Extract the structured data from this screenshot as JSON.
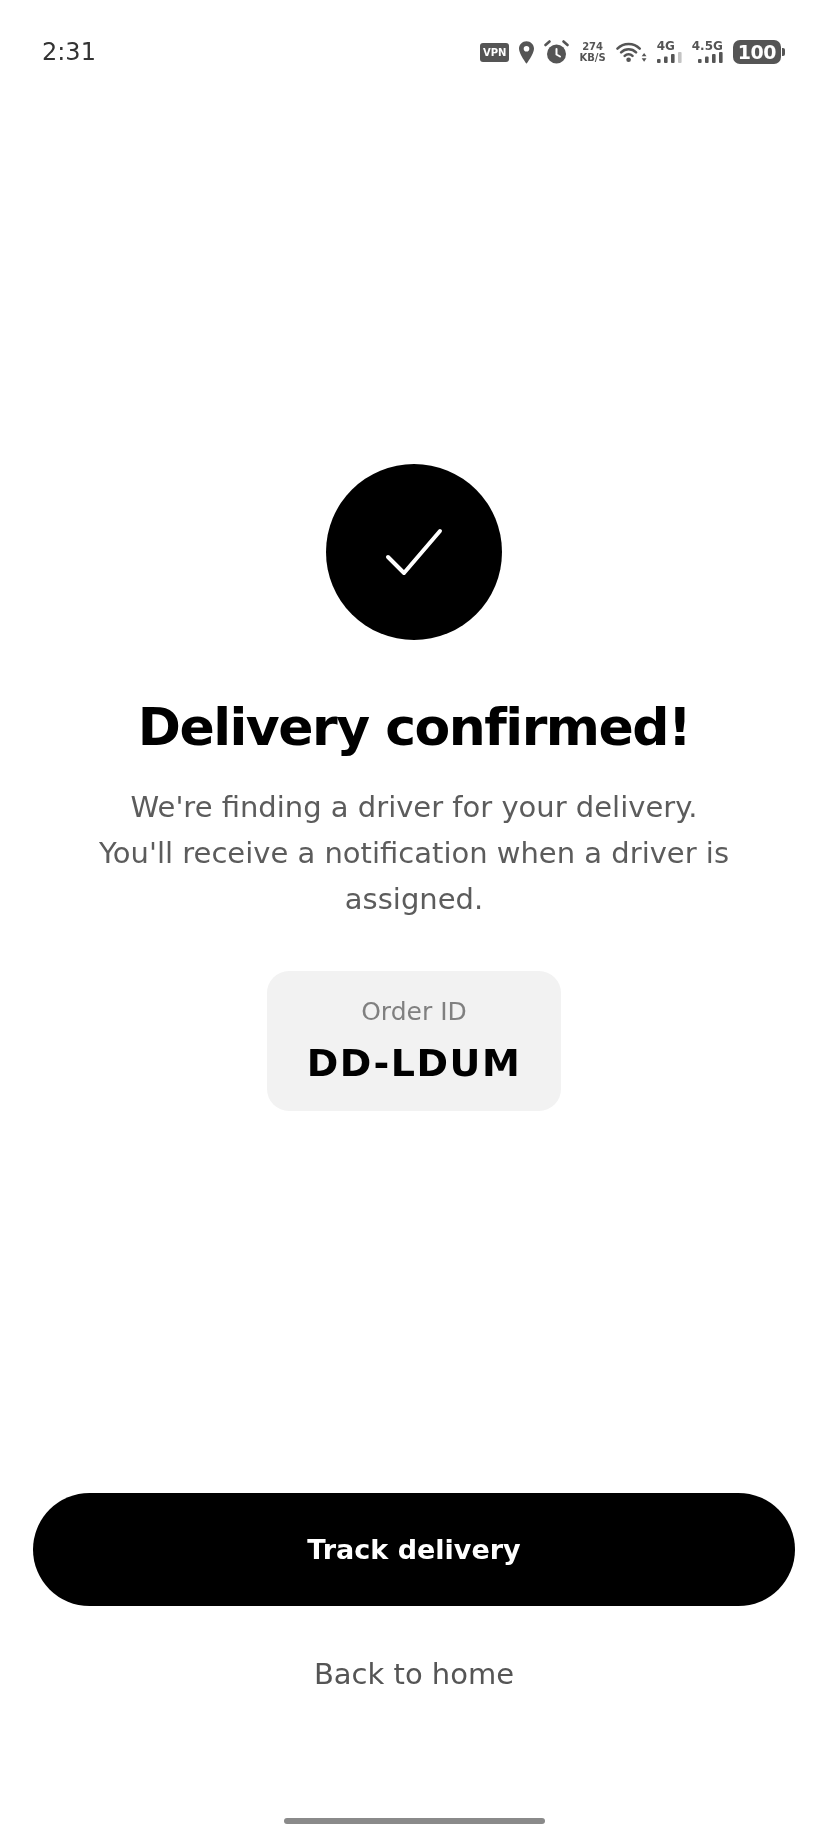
{
  "status_bar": {
    "time": "2:31",
    "vpn_label": "VPN",
    "network_speed": {
      "value": "274",
      "unit": "KB/S"
    },
    "sims": [
      {
        "network_type": "4G"
      },
      {
        "network_type": "4.5G"
      }
    ],
    "battery": {
      "percent": "100"
    }
  },
  "confirmation": {
    "title": "Delivery confirmed!",
    "message": "We're finding a driver for your delivery. You'll receive a notification when a driver is assigned."
  },
  "order": {
    "label": "Order ID",
    "value": "DD-LDUM"
  },
  "actions": [
    {
      "kind": "primary",
      "label": "Track delivery"
    },
    {
      "kind": "text",
      "label": "Back to home"
    }
  ]
}
